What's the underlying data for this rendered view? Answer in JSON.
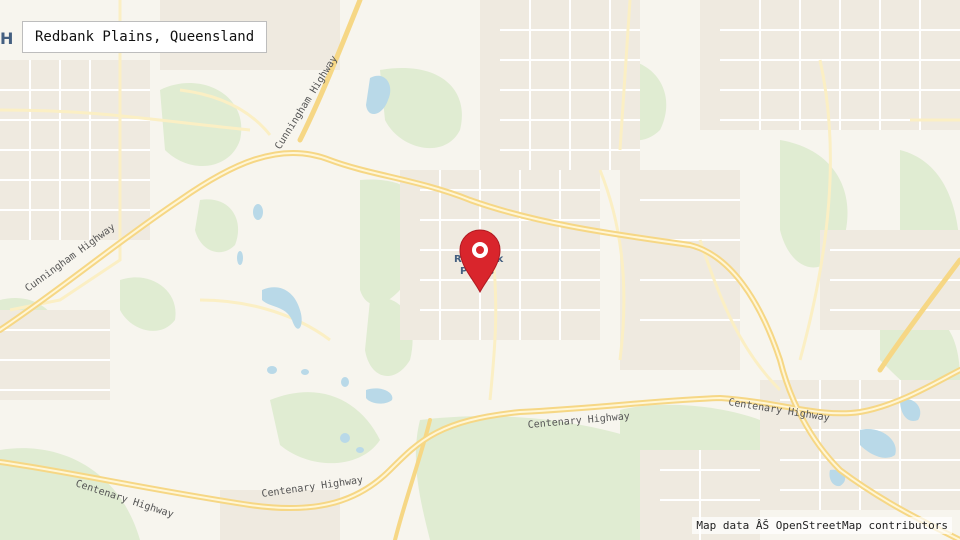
{
  "search": {
    "value": "Redbank Plains, Queensland"
  },
  "attribution": "Map data ÂŠ OpenStreetMap contributors",
  "map": {
    "place_label_line1": "Redbank",
    "place_label_line2": "Plains",
    "edge_label": "H",
    "roads": {
      "cunningham_1": "Cunningham Highway",
      "cunningham_2": "Cunningham Highway",
      "centenary_1": "Centenary Highway",
      "centenary_2": "Centenary Highway",
      "centenary_3": "Centenary Highway"
    },
    "marker": {
      "icon": "map-pin-icon",
      "color": "#d9252c"
    },
    "colors": {
      "land": "#f7f5ee",
      "green": "#dfecd0",
      "water": "#b8dae8",
      "highway": "#fbe49a",
      "street": "#ece7da"
    }
  }
}
